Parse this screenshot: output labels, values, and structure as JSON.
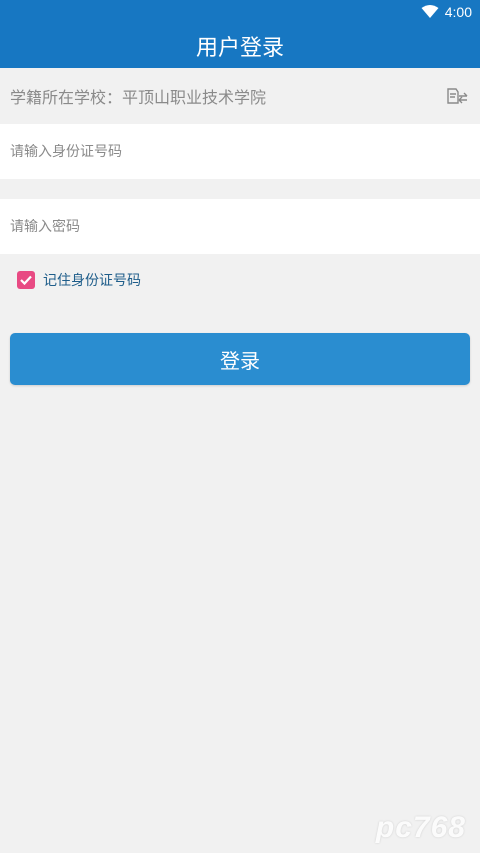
{
  "status_bar": {
    "time": "4:00"
  },
  "header": {
    "title": "用户登录"
  },
  "school": {
    "label": "学籍所在学校：",
    "name": "平顶山职业技术学院"
  },
  "id_field": {
    "placeholder": "请输入身份证号码",
    "value": ""
  },
  "password_field": {
    "placeholder": "请输入密码",
    "value": ""
  },
  "remember": {
    "label": "记住身份证号码",
    "checked": true
  },
  "login_button": {
    "label": "登录"
  },
  "watermark": {
    "text": "pc768"
  },
  "colors": {
    "primary": "#1777c2",
    "button": "#2a8dd0",
    "checkbox": "#e84a83",
    "background": "#f1f1f1"
  },
  "icons": {
    "wifi": "wifi-icon",
    "switch": "switch-school-icon",
    "check": "checkmark-icon"
  }
}
